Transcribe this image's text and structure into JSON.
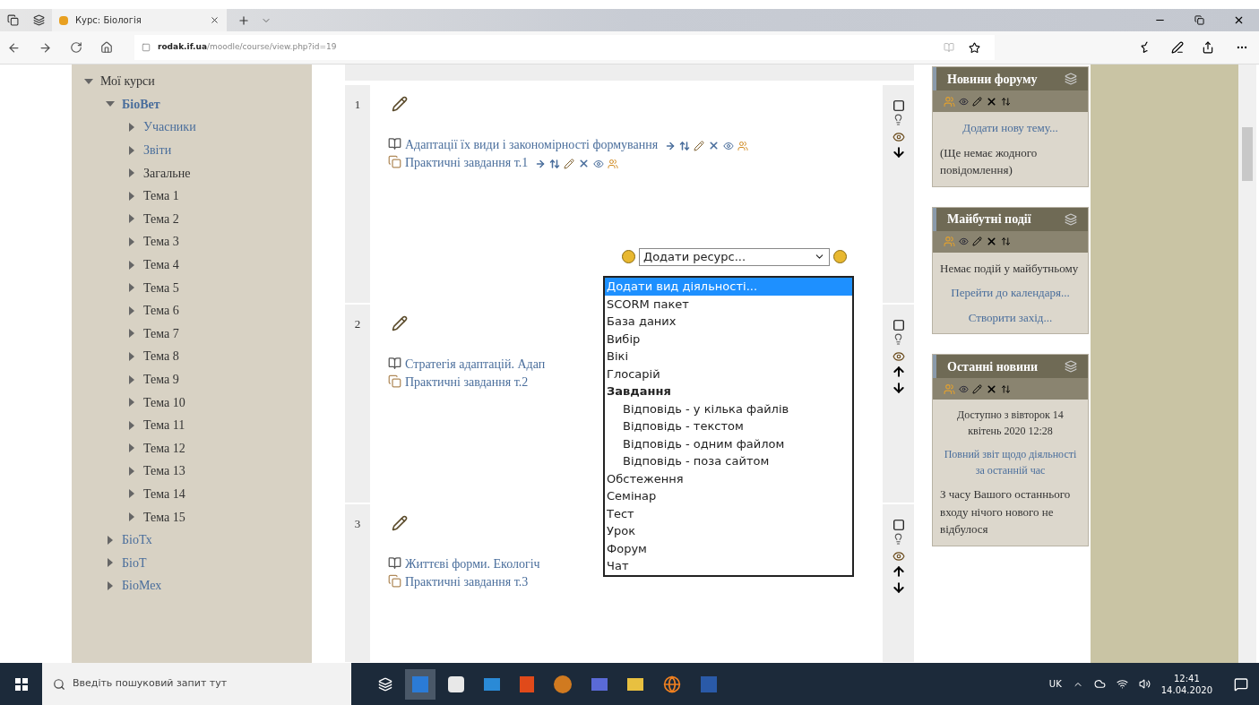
{
  "browser": {
    "tab_title": "Курс: Біологія",
    "url_host": "rodak.if.ua",
    "url_path": "/moodle/course/view.php?id=19"
  },
  "sidebar": {
    "items": [
      {
        "label": "Мої курси",
        "link": false,
        "selected": false,
        "expanded": true,
        "children": [
          {
            "label": "БіоВет",
            "link": true,
            "selected": true,
            "expanded": true,
            "children": [
              {
                "label": "Учасники",
                "link": true,
                "selected": false,
                "expanded": false
              },
              {
                "label": "Звіти",
                "link": true,
                "selected": false,
                "expanded": false
              },
              {
                "label": "Загальне",
                "link": false,
                "selected": false,
                "expanded": false
              },
              {
                "label": "Тема 1",
                "link": false,
                "selected": false,
                "expanded": false
              },
              {
                "label": "Тема 2",
                "link": false,
                "selected": false,
                "expanded": false
              },
              {
                "label": "Тема 3",
                "link": false,
                "selected": false,
                "expanded": false
              },
              {
                "label": "Тема 4",
                "link": false,
                "selected": false,
                "expanded": false
              },
              {
                "label": "Тема 5",
                "link": false,
                "selected": false,
                "expanded": false
              },
              {
                "label": "Тема 6",
                "link": false,
                "selected": false,
                "expanded": false
              },
              {
                "label": "Тема 7",
                "link": false,
                "selected": false,
                "expanded": false
              },
              {
                "label": "Тема 8",
                "link": false,
                "selected": false,
                "expanded": false
              },
              {
                "label": "Тема 9",
                "link": false,
                "selected": false,
                "expanded": false
              },
              {
                "label": "Тема 10",
                "link": false,
                "selected": false,
                "expanded": false
              },
              {
                "label": "Тема 11",
                "link": false,
                "selected": false,
                "expanded": false
              },
              {
                "label": "Тема 12",
                "link": false,
                "selected": false,
                "expanded": false
              },
              {
                "label": "Тема 13",
                "link": false,
                "selected": false,
                "expanded": false
              },
              {
                "label": "Тема 14",
                "link": false,
                "selected": false,
                "expanded": false
              },
              {
                "label": "Тема 15",
                "link": false,
                "selected": false,
                "expanded": false
              }
            ]
          },
          {
            "label": "БіоТх",
            "link": true,
            "selected": false,
            "expanded": false
          },
          {
            "label": "БіоТ",
            "link": true,
            "selected": false,
            "expanded": false
          },
          {
            "label": "БіоМех",
            "link": true,
            "selected": false,
            "expanded": false
          }
        ]
      }
    ]
  },
  "sections": [
    {
      "number": "1",
      "can_move_up": false,
      "can_move_down": true,
      "activities": [
        {
          "kind": "resource",
          "title": "Адаптації їх види і закономірності формування"
        },
        {
          "kind": "assignment",
          "title": "Практичні завдання т.1"
        }
      ],
      "add_select": {
        "value": "Додати ресурс..."
      }
    },
    {
      "number": "2",
      "can_move_up": true,
      "can_move_down": true,
      "activities": [
        {
          "kind": "resource",
          "title": "Стратегія адаптацій. Адап"
        },
        {
          "kind": "assignment",
          "title": "Практичні завдання т.2"
        }
      ]
    },
    {
      "number": "3",
      "can_move_up": true,
      "can_move_down": true,
      "activities": [
        {
          "kind": "resource",
          "title": "Життєві форми. Екологіч"
        },
        {
          "kind": "assignment",
          "title": "Практичні завдання т.3"
        }
      ]
    }
  ],
  "activity_list": {
    "options": [
      {
        "kind": "option",
        "label": "Додати вид діяльності...",
        "selected": true
      },
      {
        "kind": "option",
        "label": "SCORM пакет",
        "selected": false
      },
      {
        "kind": "option",
        "label": "База даних",
        "selected": false
      },
      {
        "kind": "option",
        "label": "Вибір",
        "selected": false
      },
      {
        "kind": "option",
        "label": "Вікі",
        "selected": false
      },
      {
        "kind": "option",
        "label": "Глосарій",
        "selected": false
      },
      {
        "kind": "group",
        "label": "Завдання",
        "selected": false
      },
      {
        "kind": "suboption",
        "label": "Відповідь - у кілька файлів",
        "selected": false
      },
      {
        "kind": "suboption",
        "label": "Відповідь - текстом",
        "selected": false
      },
      {
        "kind": "suboption",
        "label": "Відповідь - одним файлом",
        "selected": false
      },
      {
        "kind": "suboption",
        "label": "Відповідь - поза сайтом",
        "selected": false
      },
      {
        "kind": "option",
        "label": "Обстеження",
        "selected": false
      },
      {
        "kind": "option",
        "label": "Семінар",
        "selected": false
      },
      {
        "kind": "option",
        "label": "Тест",
        "selected": false
      },
      {
        "kind": "option",
        "label": "Урок",
        "selected": false
      },
      {
        "kind": "option",
        "label": "Форум",
        "selected": false
      },
      {
        "kind": "option",
        "label": "Чат",
        "selected": false
      }
    ]
  },
  "blocks": [
    {
      "title": "Новини форуму",
      "body": [
        {
          "kind": "link",
          "text": "Додати нову тему...",
          "centered": true,
          "small": false
        },
        {
          "kind": "text",
          "text": "(Ще немає жодного повідомлення)",
          "centered": false,
          "small": false
        }
      ]
    },
    {
      "title": "Майбутні події",
      "body": [
        {
          "kind": "text",
          "text": "Немає подій у майбутньому",
          "centered": false,
          "small": false
        },
        {
          "kind": "link",
          "text": "Перейти до календаря...",
          "centered": true,
          "small": false
        },
        {
          "kind": "link",
          "text": "Створити захід...",
          "centered": true,
          "small": false
        }
      ]
    },
    {
      "title": "Останні новини",
      "body": [
        {
          "kind": "text",
          "text": "Доступно з вівторок 14 квітень 2020 12:28",
          "centered": true,
          "small": true
        },
        {
          "kind": "link",
          "text": "Повний звіт щодо діяльності за останній час",
          "centered": true,
          "small": true
        },
        {
          "kind": "text",
          "text": "З часу Вашого останнього входу нічого нового не відбулося",
          "centered": false,
          "small": false
        }
      ]
    }
  ],
  "taskbar": {
    "search_placeholder": "Введіть пошуковий запит тут",
    "language": "UK",
    "time": "12:41",
    "date": "14.04.2020"
  }
}
